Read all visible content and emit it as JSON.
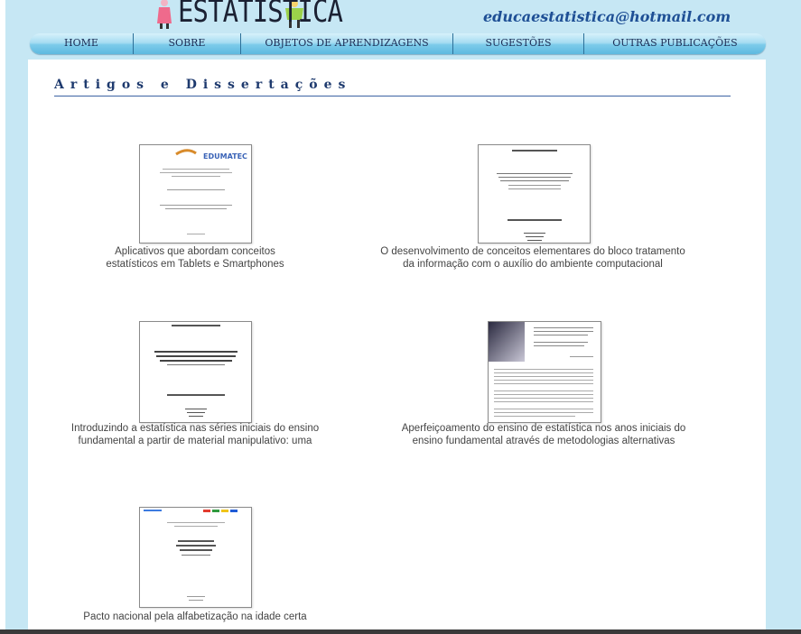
{
  "header": {
    "logo_text": "ESTATÍSTICA",
    "email": "educaestatistica@hotmail.com"
  },
  "nav": {
    "items": [
      {
        "label": "HOME"
      },
      {
        "label": "SOBRE"
      },
      {
        "label": "OBJETOS DE APRENDIZAGENS"
      },
      {
        "label": "SUGESTÕES"
      },
      {
        "label": "OUTRAS PUBLICAÇÕES"
      }
    ]
  },
  "section": {
    "title": "Artigos e Dissertações"
  },
  "items": [
    {
      "caption_line1": "Aplicativos que abordam conceitos",
      "caption_line2": "estatísticos em Tablets e Smartphones",
      "thumb_logo": "EDUMATEC"
    },
    {
      "caption_line1": "O desenvolvimento de conceitos elementares do bloco tratamento",
      "caption_line2": "da informação com o auxílio do ambiente computacional"
    },
    {
      "caption_line1": "Introduzindo a estatística nas séries iniciais do ensino",
      "caption_line2": "fundamental a partir de material manipulativo: uma"
    },
    {
      "caption_line1": "Aperfeiçoamento do ensino de estatística nos anos iniciais do",
      "caption_line2": "ensino fundamental através de metodologias alternativas"
    },
    {
      "caption_line1": "Pacto nacional pela alfabetização na idade certa",
      "caption_line2": ""
    }
  ],
  "colors": {
    "page_bg": "#c6e7f4",
    "nav_text": "#1c2d55",
    "title": "#1e3a6e",
    "email": "#1e4f95"
  }
}
